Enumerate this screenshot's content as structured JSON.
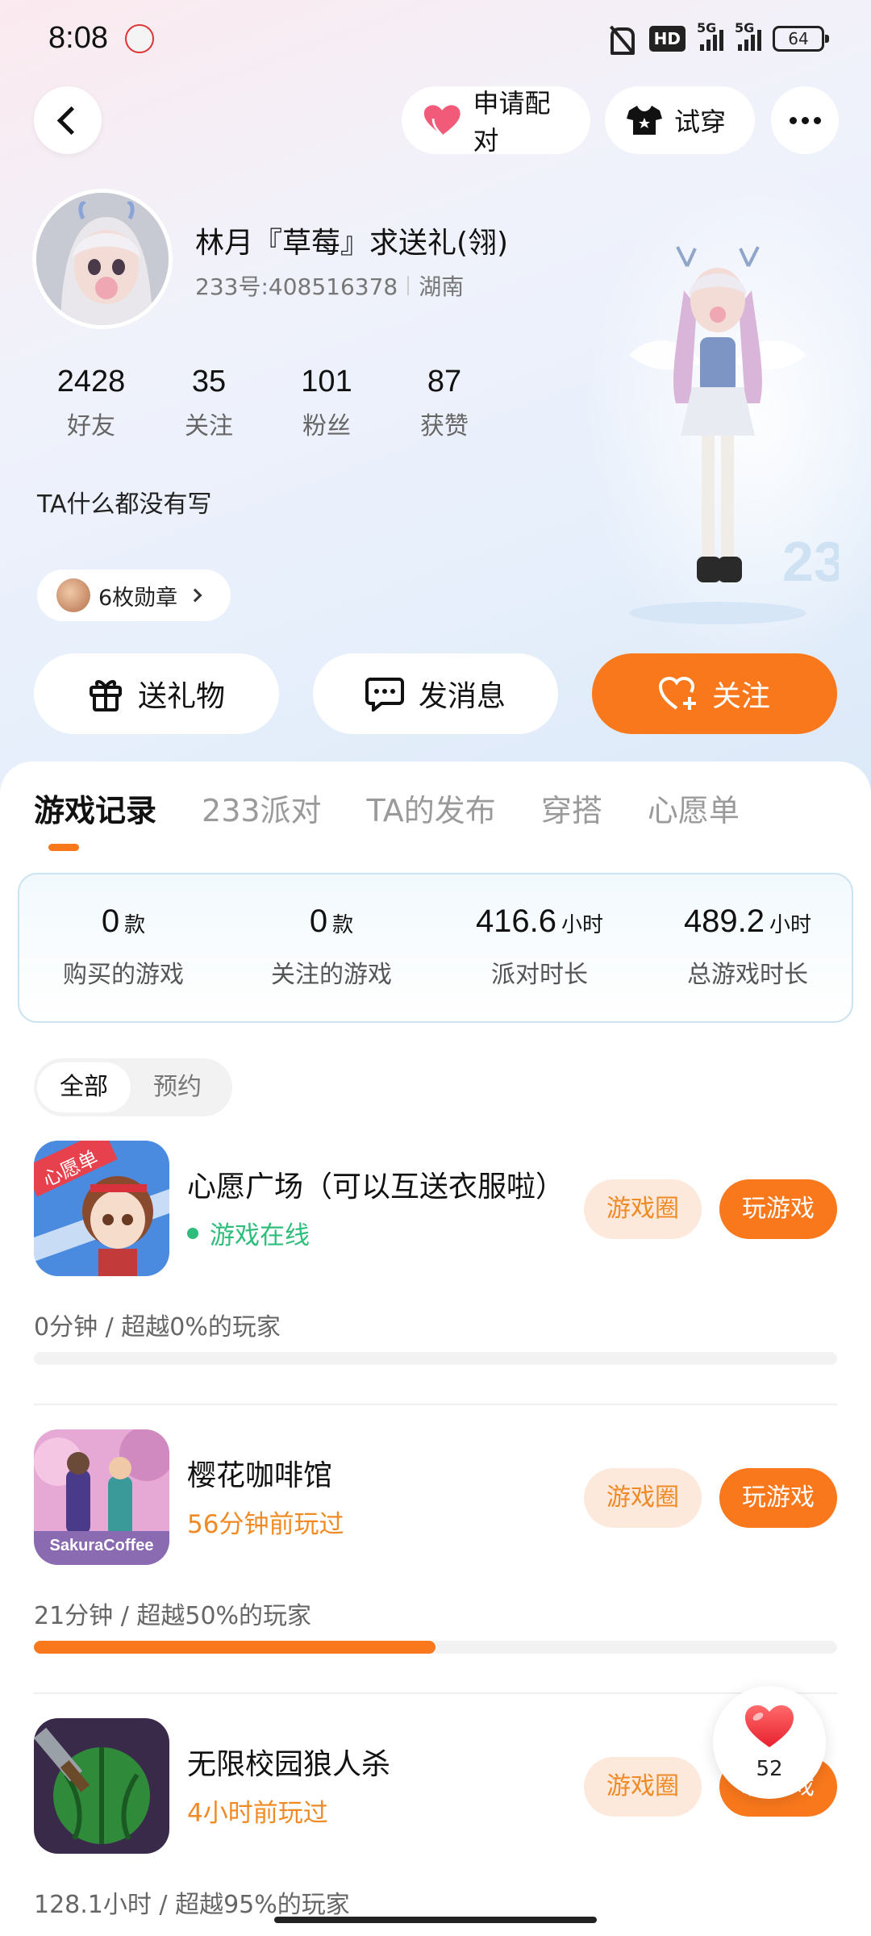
{
  "status_bar": {
    "time": "8:08",
    "hd_label": "HD",
    "network_1": "5G",
    "network_2": "5G",
    "battery": "64"
  },
  "header": {
    "pair_label": "申请配对",
    "try_on_label": "试穿"
  },
  "profile": {
    "name": "林月『草莓』求送礼(翎)",
    "id_text": "233号:408516378",
    "region": "湖南",
    "bio": "TA什么都没有写",
    "medals": "6枚勋章",
    "stats": [
      {
        "num": "2428",
        "label": "好友"
      },
      {
        "num": "35",
        "label": "关注"
      },
      {
        "num": "101",
        "label": "粉丝"
      },
      {
        "num": "87",
        "label": "获赞"
      }
    ]
  },
  "actions": {
    "gift": "送礼物",
    "message": "发消息",
    "follow": "关注"
  },
  "tabs": [
    "游戏记录",
    "233派对",
    "TA的发布",
    "穿搭",
    "心愿单"
  ],
  "summary": [
    {
      "value": "0",
      "unit": "款",
      "label": "购买的游戏"
    },
    {
      "value": "0",
      "unit": "款",
      "label": "关注的游戏"
    },
    {
      "value": "416.6",
      "unit": "小时",
      "label": "派对时长"
    },
    {
      "value": "489.2",
      "unit": "小时",
      "label": "总游戏时长"
    }
  ],
  "filter": [
    "全部",
    "预约"
  ],
  "games": [
    {
      "title": "心愿广场（可以互送衣服啦）",
      "status": "游戏在线",
      "status_type": "online",
      "time_text": "0分钟 / 超越0%的玩家",
      "progress": 0,
      "circle_label": "游戏圈",
      "play_label": "玩游戏",
      "icon_text": "心愿单"
    },
    {
      "title": "樱花咖啡馆",
      "status": "56分钟前玩过",
      "status_type": "played",
      "time_text": "21分钟 / 超越50%的玩家",
      "progress": 0.5,
      "circle_label": "游戏圈",
      "play_label": "玩游戏",
      "icon_text": "SakuraCoffee"
    },
    {
      "title": "无限校园狼人杀",
      "status": "4小时前玩过",
      "status_type": "played",
      "time_text": "128.1小时 / 超越95%的玩家",
      "progress": 0.95,
      "circle_label": "游戏圈",
      "play_label": "玩游戏",
      "icon_text": ""
    }
  ],
  "like": {
    "count": "52"
  },
  "colors": {
    "accent": "#f9781c",
    "online": "#2ebd7a",
    "played": "#f08a24"
  }
}
